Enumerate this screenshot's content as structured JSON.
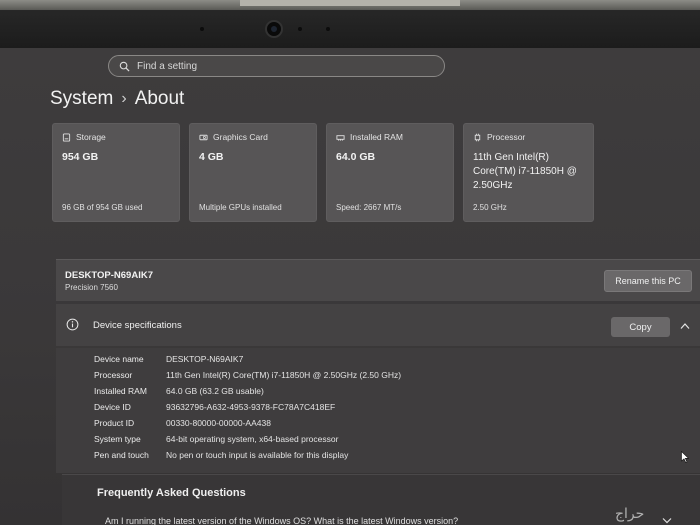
{
  "search": {
    "placeholder": "Find a setting"
  },
  "breadcrumb": {
    "parent": "System",
    "separator": "›",
    "current": "About"
  },
  "cards": [
    {
      "icon": "storage-icon",
      "title": "Storage",
      "value": "954 GB",
      "footer": "96 GB of 954 GB used"
    },
    {
      "icon": "graphics-card-icon",
      "title": "Graphics Card",
      "value": "4 GB",
      "footer": "Multiple GPUs installed"
    },
    {
      "icon": "ram-icon",
      "title": "Installed RAM",
      "value": "64.0 GB",
      "footer": "Speed: 2667 MT/s"
    },
    {
      "icon": "processor-icon",
      "title": "Processor",
      "value": "11th Gen Intel(R) Core(TM) i7-11850H @ 2.50GHz",
      "footer": "2.50 GHz"
    }
  ],
  "device": {
    "name": "DESKTOP-N69AIK7",
    "model": "Precision 7560",
    "rename_label": "Rename this PC"
  },
  "specs": {
    "title": "Device specifications",
    "copy_label": "Copy",
    "rows": [
      {
        "key": "Device name",
        "value": "DESKTOP-N69AIK7"
      },
      {
        "key": "Processor",
        "value": "11th Gen Intel(R) Core(TM) i7-11850H @ 2.50GHz (2.50 GHz)"
      },
      {
        "key": "Installed RAM",
        "value": "64.0 GB (63.2 GB usable)"
      },
      {
        "key": "Device ID",
        "value": "93632796-A632-4953-9378-FC78A7C418EF"
      },
      {
        "key": "Product ID",
        "value": "00330-80000-00000-AA438"
      },
      {
        "key": "System type",
        "value": "64-bit operating system, x64-based processor"
      },
      {
        "key": "Pen and touch",
        "value": "No pen or touch input is available for this display"
      }
    ]
  },
  "faq": {
    "title": "Frequently Asked Questions",
    "question": "Am I running the latest version of the Windows OS? What is the latest Windows version?"
  },
  "watermark": "حراج"
}
